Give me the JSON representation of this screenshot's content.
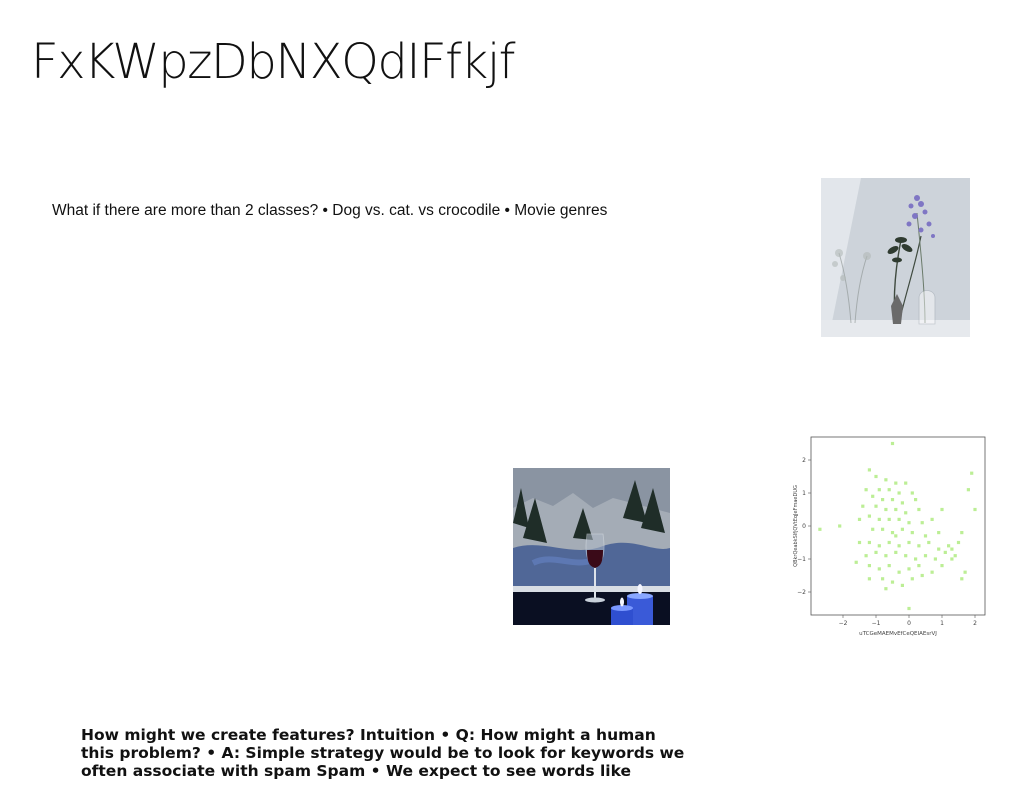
{
  "slide": {
    "title": "FxKWpzDbNXQdIFfkjf",
    "body_text": "What if there are more than 2 classes? • Dog vs. cat. vs crocodile • Movie genres",
    "bottom_text": "How might we create features? Intuition • Q: How might a human this problem? • A: Simple strategy would be to look for keywords we often associate with spam Spam • We expect to see words like"
  },
  "images": {
    "flowers": "vase-with-flowers-photo",
    "candles": "wine-glass-and-candles-photo"
  },
  "chart_data": {
    "type": "scatter",
    "xlabel": "uTCGeMAEMvEfCeQEIAEsrVJ",
    "ylabel": "QBkrQeabkSIfjQVtEqJeFmaeDUG",
    "xlim": [
      -2.8,
      2.3
    ],
    "ylim": [
      -2.7,
      2.5
    ],
    "x_ticks": [
      "−2",
      "−1",
      "0",
      "1",
      "2"
    ],
    "y_ticks": [
      "2",
      "1",
      "0",
      "−1",
      "−2"
    ],
    "marker_color": "#b5ec8a",
    "grid": false,
    "points": [
      [
        -0.5,
        2.5
      ],
      [
        -1.2,
        1.7
      ],
      [
        -1.0,
        1.5
      ],
      [
        -0.7,
        1.4
      ],
      [
        -0.4,
        1.3
      ],
      [
        -0.1,
        1.3
      ],
      [
        -1.3,
        1.1
      ],
      [
        -0.9,
        1.1
      ],
      [
        -0.6,
        1.1
      ],
      [
        -0.3,
        1.0
      ],
      [
        0.1,
        1.0
      ],
      [
        -1.1,
        0.9
      ],
      [
        -0.8,
        0.8
      ],
      [
        -0.5,
        0.8
      ],
      [
        -0.2,
        0.7
      ],
      [
        0.2,
        0.8
      ],
      [
        1.9,
        1.6
      ],
      [
        1.8,
        1.1
      ],
      [
        -1.4,
        0.6
      ],
      [
        -1.0,
        0.6
      ],
      [
        -0.7,
        0.5
      ],
      [
        -0.4,
        0.5
      ],
      [
        -0.1,
        0.4
      ],
      [
        0.3,
        0.5
      ],
      [
        1.0,
        0.5
      ],
      [
        2.0,
        0.5
      ],
      [
        -1.5,
        0.2
      ],
      [
        -1.2,
        0.3
      ],
      [
        -0.9,
        0.2
      ],
      [
        -0.6,
        0.2
      ],
      [
        -0.3,
        0.2
      ],
      [
        0.0,
        0.1
      ],
      [
        0.4,
        0.1
      ],
      [
        0.7,
        0.2
      ],
      [
        -2.7,
        -0.1
      ],
      [
        -2.1,
        0.0
      ],
      [
        -1.1,
        -0.1
      ],
      [
        -0.8,
        -0.1
      ],
      [
        -0.5,
        -0.2
      ],
      [
        -0.2,
        -0.1
      ],
      [
        0.1,
        -0.2
      ],
      [
        0.5,
        -0.3
      ],
      [
        0.9,
        -0.2
      ],
      [
        1.6,
        -0.2
      ],
      [
        -1.5,
        -0.5
      ],
      [
        -1.2,
        -0.5
      ],
      [
        -0.9,
        -0.6
      ],
      [
        -0.6,
        -0.5
      ],
      [
        -0.3,
        -0.6
      ],
      [
        0.0,
        -0.5
      ],
      [
        0.3,
        -0.6
      ],
      [
        0.6,
        -0.5
      ],
      [
        0.9,
        -0.7
      ],
      [
        1.2,
        -0.6
      ],
      [
        1.5,
        -0.5
      ],
      [
        -1.3,
        -0.9
      ],
      [
        -1.0,
        -0.8
      ],
      [
        -0.7,
        -0.9
      ],
      [
        -0.4,
        -0.8
      ],
      [
        -0.1,
        -0.9
      ],
      [
        0.2,
        -1.0
      ],
      [
        0.5,
        -0.9
      ],
      [
        0.8,
        -1.0
      ],
      [
        1.1,
        -0.8
      ],
      [
        1.4,
        -0.9
      ],
      [
        -1.6,
        -1.1
      ],
      [
        -1.2,
        -1.2
      ],
      [
        -0.9,
        -1.3
      ],
      [
        -0.6,
        -1.2
      ],
      [
        -0.3,
        -1.4
      ],
      [
        0.0,
        -1.3
      ],
      [
        0.3,
        -1.2
      ],
      [
        0.7,
        -1.4
      ],
      [
        1.0,
        -1.2
      ],
      [
        -1.2,
        -1.6
      ],
      [
        -0.8,
        -1.6
      ],
      [
        -0.5,
        -1.7
      ],
      [
        -0.2,
        -1.8
      ],
      [
        0.1,
        -1.6
      ],
      [
        0.4,
        -1.5
      ],
      [
        1.7,
        -1.4
      ],
      [
        1.6,
        -1.6
      ],
      [
        0.0,
        -2.5
      ],
      [
        -0.7,
        -1.9
      ],
      [
        1.3,
        -0.7
      ],
      [
        1.3,
        -1.0
      ],
      [
        -0.4,
        -0.3
      ]
    ]
  }
}
